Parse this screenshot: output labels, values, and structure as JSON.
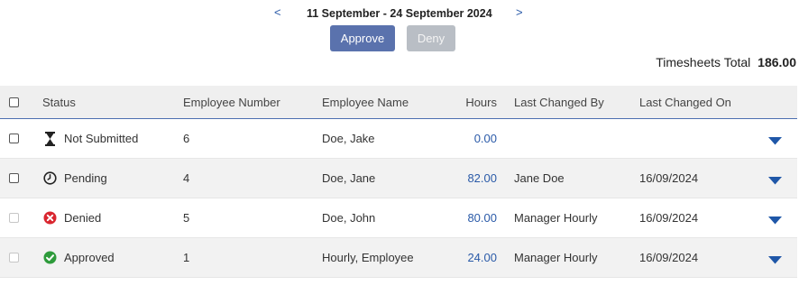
{
  "period": {
    "prev_icon": "chevron-left-icon",
    "prev_glyph": "<",
    "label": "11 September - 24 September 2024",
    "next_icon": "chevron-right-icon",
    "next_glyph": ">"
  },
  "actions": {
    "approve_label": "Approve",
    "deny_label": "Deny",
    "deny_disabled": true
  },
  "total": {
    "label": "Timesheets Total",
    "value": "186.00"
  },
  "colors": {
    "accent": "#5a72ad",
    "link": "#2a5aa8",
    "disabled": "#b9bec5",
    "denied": "#d9262f",
    "approved": "#2e9b3b"
  },
  "table": {
    "columns": {
      "status": "Status",
      "employee_number": "Employee Number",
      "employee_name": "Employee Name",
      "hours": "Hours",
      "last_changed_by": "Last Changed By",
      "last_changed_on": "Last Changed On"
    },
    "rows": [
      {
        "status": "Not Submitted",
        "status_icon": "hourglass-icon",
        "employee_number": "6",
        "employee_name": "Doe, Jake",
        "hours": "0.00",
        "last_changed_by": "",
        "last_changed_on": "",
        "checkbox_enabled": true
      },
      {
        "status": "Pending",
        "status_icon": "clock-icon",
        "employee_number": "4",
        "employee_name": "Doe, Jane",
        "hours": "82.00",
        "last_changed_by": "Jane Doe",
        "last_changed_on": "16/09/2024",
        "checkbox_enabled": true
      },
      {
        "status": "Denied",
        "status_icon": "denied-x-icon",
        "employee_number": "5",
        "employee_name": "Doe, John",
        "hours": "80.00",
        "last_changed_by": "Manager Hourly",
        "last_changed_on": "16/09/2024",
        "checkbox_enabled": false
      },
      {
        "status": "Approved",
        "status_icon": "approved-check-icon",
        "employee_number": "1",
        "employee_name": "Hourly, Employee",
        "hours": "24.00",
        "last_changed_by": "Manager Hourly",
        "last_changed_on": "16/09/2024",
        "checkbox_enabled": false
      }
    ]
  }
}
